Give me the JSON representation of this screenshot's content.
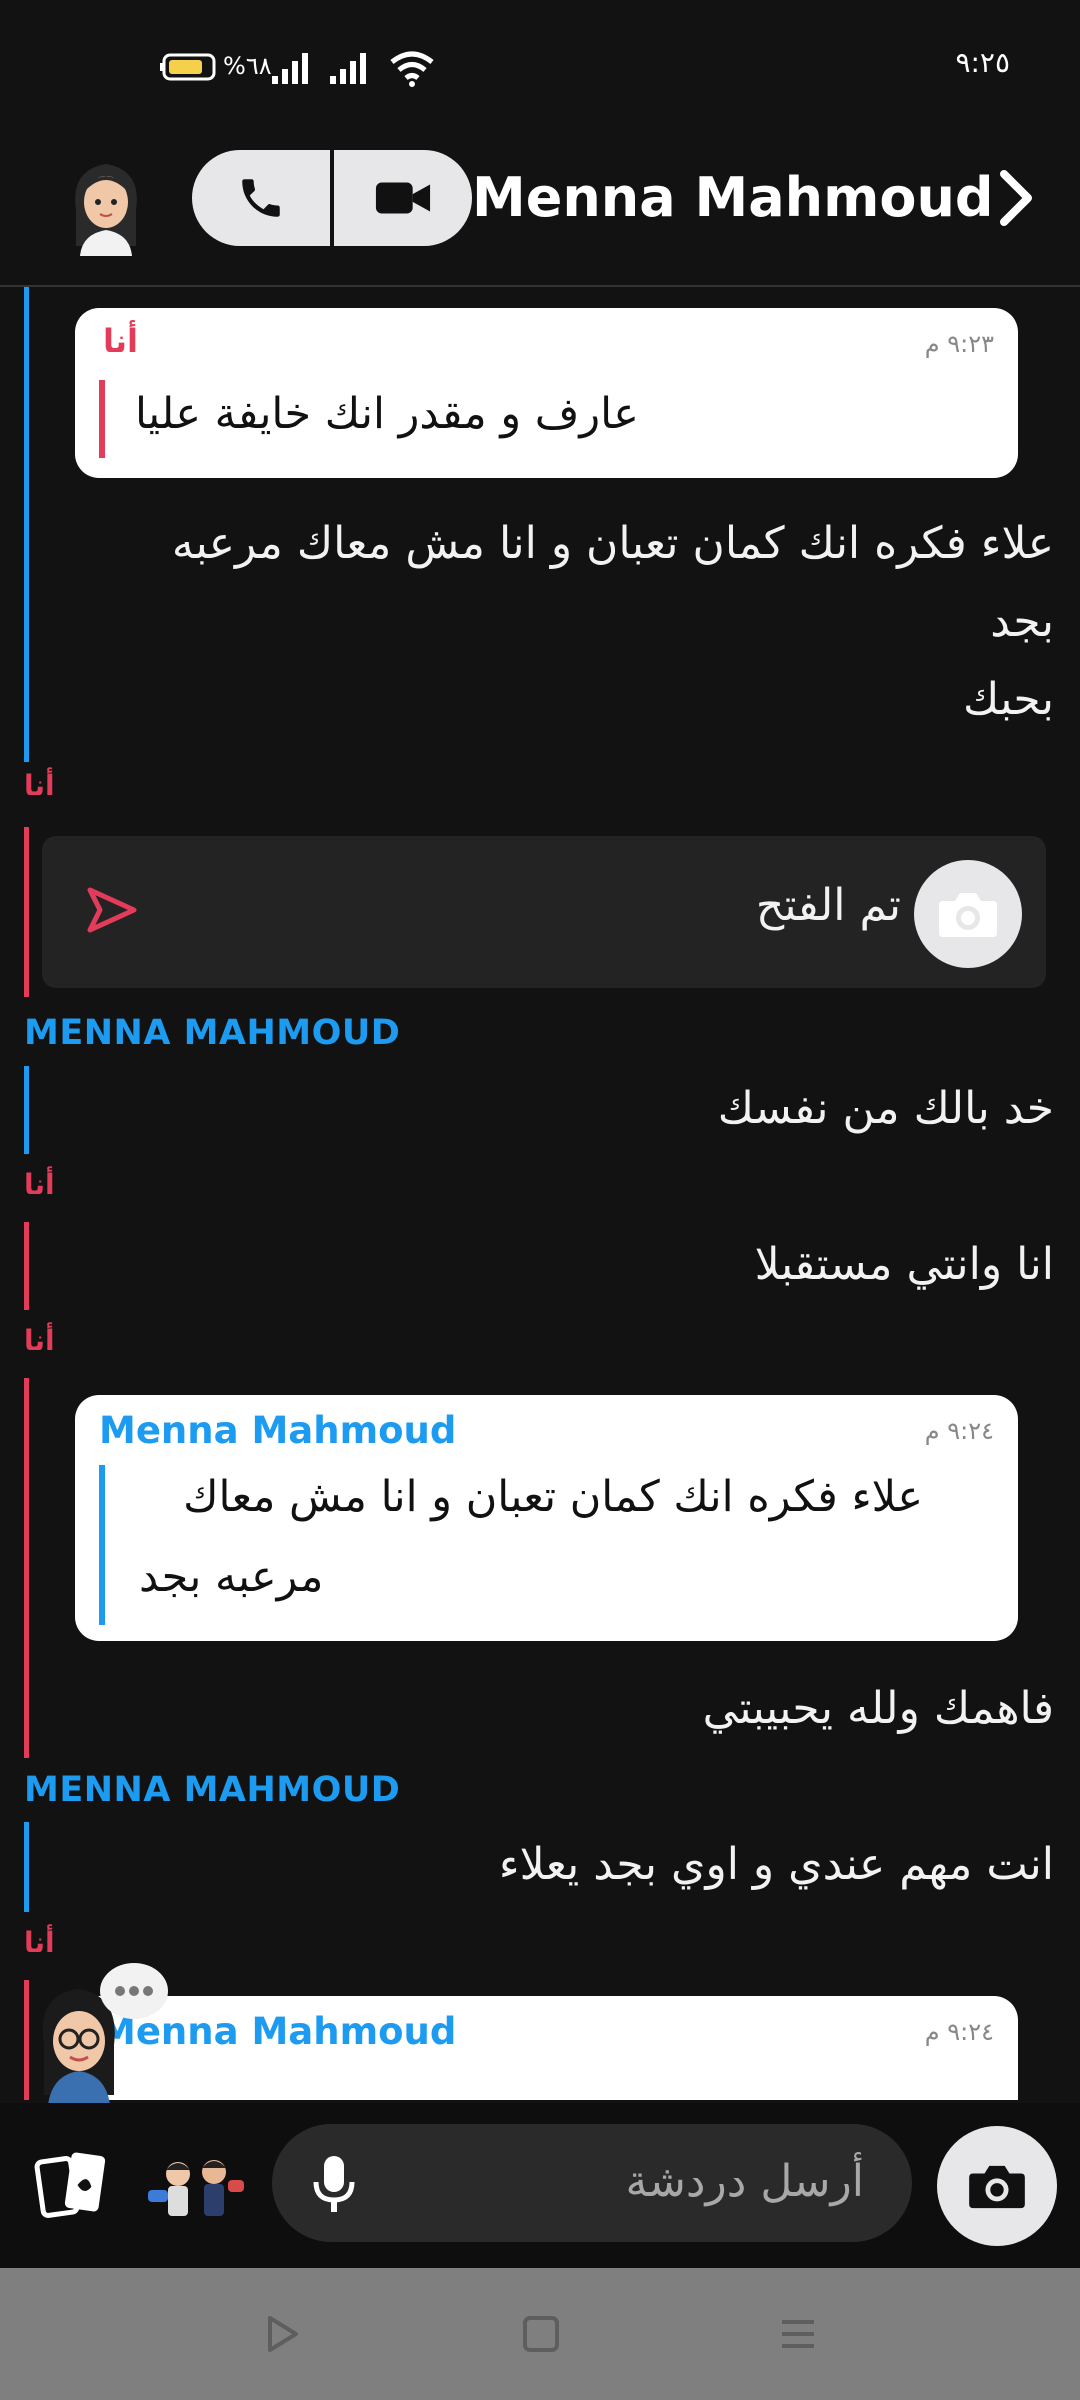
{
  "status_bar": {
    "time": "٩:٢٥",
    "battery_percent": "%٦٨"
  },
  "header": {
    "contact_name": "Menna Mahmoud"
  },
  "chat": {
    "quote1": {
      "sender": "أنا",
      "time": "٩:٢٣ م",
      "text": "عارف و مقدر انك خايفة عليا"
    },
    "msg1_line1": "علاء فكره انك كمان تعبان و انا مش معاك مرعبه",
    "msg1_line2": "بجد",
    "msg1_line3": "بحبك",
    "label_me_1": "أنا",
    "snap_status": "تم الفتح",
    "label_menna_1": "MENNA MAHMOUD",
    "msg2": "خد بالك من نفسك",
    "label_me_2": "أنا",
    "msg3": "انا وانتي مستقبلا",
    "label_me_3": "أنا",
    "quote2": {
      "sender": "Menna Mahmoud",
      "time": "٩:٢٤ م",
      "text_line1": "علاء فكره انك كمان تعبان و انا مش معاك",
      "text_line2": "مرعبه بجد"
    },
    "msg4": "فاهمك ولله يحبيبتي",
    "label_menna_2": "MENNA MAHMOUD",
    "msg5": "انت مهم عندي و اوي بجد يعلاء",
    "label_me_4": "أنا",
    "quote3": {
      "sender": "Menna Mahmoud",
      "time": "٩:٢٤ م"
    }
  },
  "input": {
    "placeholder": "أرسل دردشة"
  },
  "colors": {
    "me": "#e33b5a",
    "friend": "#1d9bf0",
    "background": "#121212"
  }
}
